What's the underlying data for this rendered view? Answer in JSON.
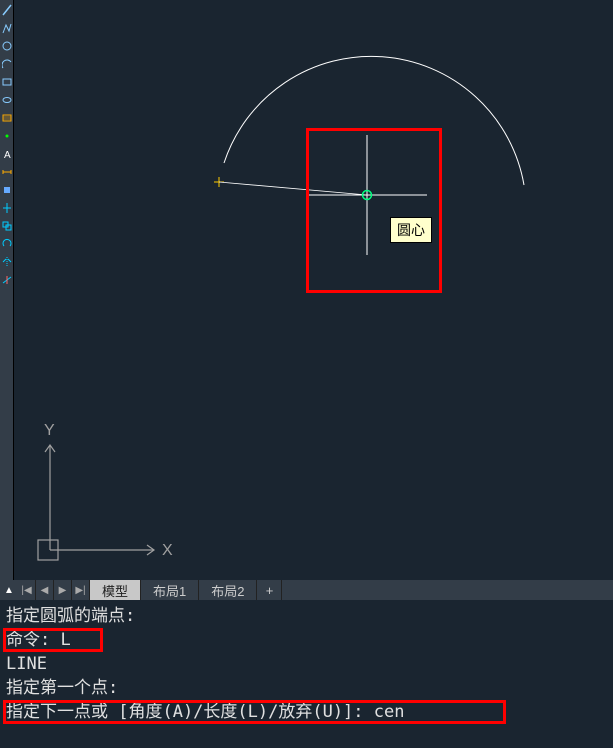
{
  "toolbar": {
    "icons": [
      "line-icon",
      "polyline-icon",
      "circle-icon",
      "arc-icon",
      "rectangle-icon",
      "ellipse-icon",
      "hatch-icon",
      "point-icon",
      "text-icon",
      "dim-icon",
      "block-icon",
      "move-icon",
      "copy-icon",
      "rotate-icon",
      "mirror-icon",
      "trim-icon"
    ]
  },
  "tooltip": {
    "center": "圆心"
  },
  "ucs": {
    "x": "X",
    "y": "Y"
  },
  "tabs": {
    "toggle": "▲",
    "nav_first": "|◀",
    "nav_prev": "◀",
    "nav_next": "▶",
    "nav_last": "▶|",
    "model": "模型",
    "layout1": "布局1",
    "layout2": "布局2",
    "add": "+"
  },
  "command": {
    "line1": "指定圆弧的端点:",
    "line2": "命令: L",
    "line3": "LINE",
    "line4": "指定第一个点:",
    "line5": "指定下一点或 [角度(A)/长度(L)/放弃(U)]: cen"
  }
}
